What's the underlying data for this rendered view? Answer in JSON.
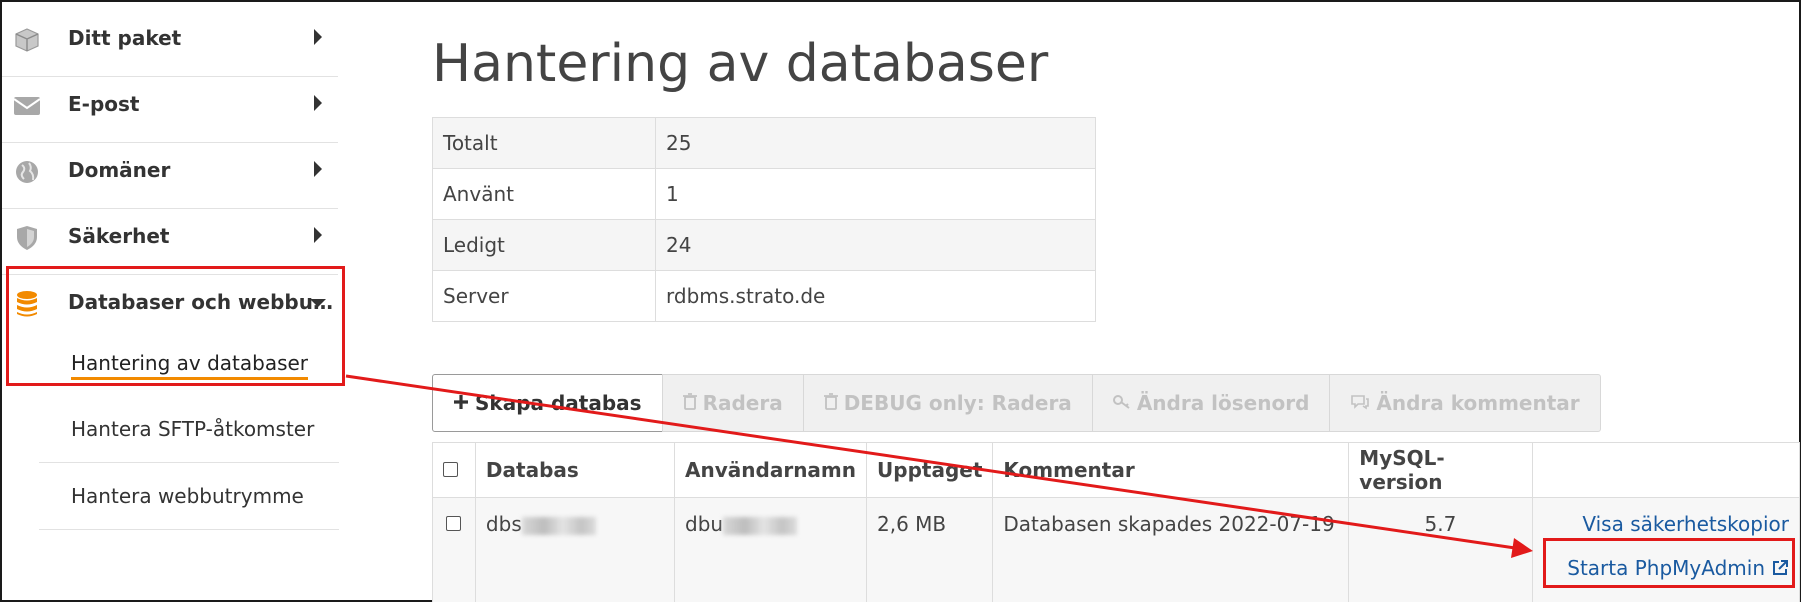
{
  "sidebar": {
    "items": [
      {
        "label": "Ditt paket",
        "icon": "package-icon"
      },
      {
        "label": "E-post",
        "icon": "envelope-icon"
      },
      {
        "label": "Domäner",
        "icon": "globe-icon"
      },
      {
        "label": "Säkerhet",
        "icon": "shield-icon"
      },
      {
        "label": "Databaser och webbu…",
        "icon": "database-icon"
      }
    ],
    "subitems": [
      {
        "label": "Hantering av databaser",
        "active": true
      },
      {
        "label": "Hantera SFTP-åtkomster"
      },
      {
        "label": "Hantera webbutrymme"
      }
    ]
  },
  "main": {
    "title": "Hantering av databaser",
    "summary": [
      {
        "label": "Totalt",
        "value": "25"
      },
      {
        "label": "Använt",
        "value": "1"
      },
      {
        "label": "Ledigt",
        "value": "24"
      },
      {
        "label": "Server",
        "value": "rdbms.strato.de"
      }
    ],
    "toolbar": {
      "create": "Skapa databas",
      "delete": "Radera",
      "debug_delete": "DEBUG only: Radera",
      "change_password": "Ändra lösenord",
      "change_comment": "Ändra kommentar"
    },
    "table": {
      "headers": {
        "database": "Databas",
        "username": "Användarnamn",
        "used": "Upptaget",
        "comment": "Kommentar",
        "mysql": "MySQL-version"
      },
      "rows": [
        {
          "database_prefix": "dbs",
          "username_prefix": "dbu",
          "used": "2,6 MB",
          "comment": "Databasen skapades 2022-07-19",
          "mysql": "5.7",
          "action_backups": "Visa säkerhetskopior",
          "action_phpmyadmin": "Starta PhpMyAdmin"
        }
      ]
    }
  },
  "colors": {
    "accent": "#f28a00",
    "link": "#1a5aa0",
    "annotation": "#e21a1a"
  }
}
